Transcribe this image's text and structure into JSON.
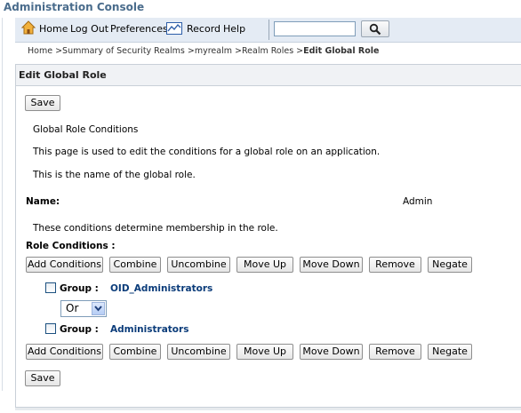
{
  "app": {
    "title": "Administration Console"
  },
  "toolbar": {
    "home": "Home",
    "logout": "Log Out",
    "preferences": "Preferences",
    "record": "Record",
    "help": "Help",
    "search_value": "",
    "icons": {
      "home": "home-icon",
      "record": "record-icon",
      "search": "search-icon"
    }
  },
  "breadcrumb": {
    "items": [
      "Home >",
      "Summary of Security Realms >",
      "myrealm >",
      "Realm Roles >"
    ],
    "current": "Edit Global Role"
  },
  "panel": {
    "title": "Edit Global Role",
    "save_label": "Save",
    "section_title": "Global Role Conditions",
    "description": "This page is used to edit the conditions for a global role on an application.",
    "name_help": "This is the name of the global role.",
    "name_label": "Name:",
    "name_value": "Admin",
    "conditions_help": "These conditions determine membership in the role.",
    "conditions_label": "Role Conditions :",
    "buttons": {
      "add_conditions": "Add Conditions",
      "combine": "Combine",
      "uncombine": "Uncombine",
      "move_up": "Move Up",
      "move_down": "Move Down",
      "remove": "Remove",
      "negate": "Negate"
    },
    "conditions": [
      {
        "label": "Group :",
        "value": "OID_Administrators"
      },
      {
        "label": "Group :",
        "value": "Administrators"
      }
    ],
    "operator": {
      "selected": "Or"
    }
  }
}
